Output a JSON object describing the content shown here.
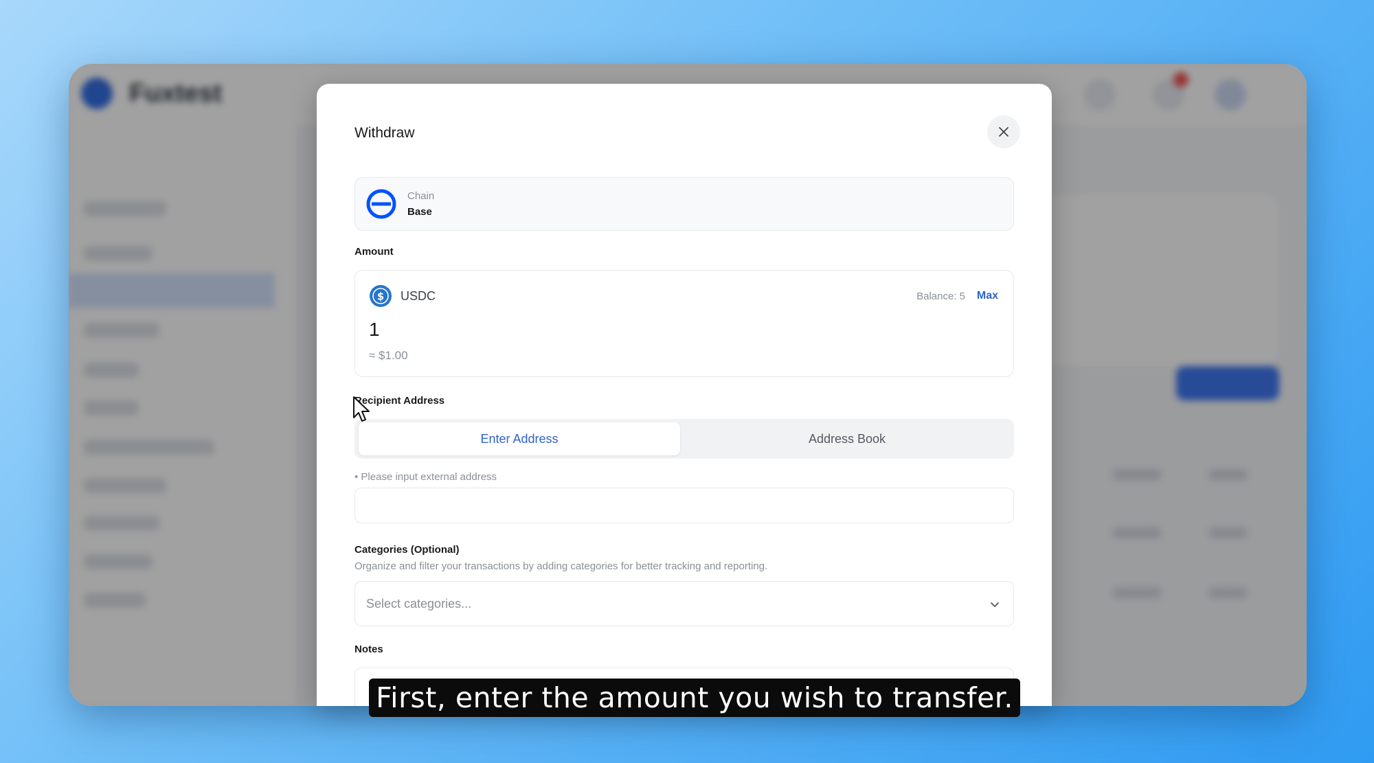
{
  "background_app": {
    "brand_name": "Fuxtest"
  },
  "modal": {
    "title": "Withdraw",
    "chain": {
      "label": "Chain",
      "value": "Base",
      "icon": "base-chain-icon"
    },
    "amount": {
      "label": "Amount",
      "token": "USDC",
      "token_icon": "usdc-icon",
      "balance": "Balance: 5",
      "max_label": "Max",
      "value": "1",
      "usd_value": "≈ $1.00"
    },
    "recipient": {
      "label": "Recipient Address",
      "tabs": [
        {
          "label": "Enter Address",
          "active": true
        },
        {
          "label": "Address Book",
          "active": false
        }
      ],
      "hint": "• Please input external address",
      "input_value": ""
    },
    "categories": {
      "label": "Categories (Optional)",
      "description": "Organize and filter your transactions by adding categories for better tracking and reporting.",
      "placeholder": "Select categories..."
    },
    "notes": {
      "label": "Notes"
    }
  },
  "caption": "First, enter the amount you wish to transfer.",
  "colors": {
    "accent": "#2f63c9",
    "chain_blue": "#0052ff",
    "usdc_blue": "#2775ca"
  }
}
